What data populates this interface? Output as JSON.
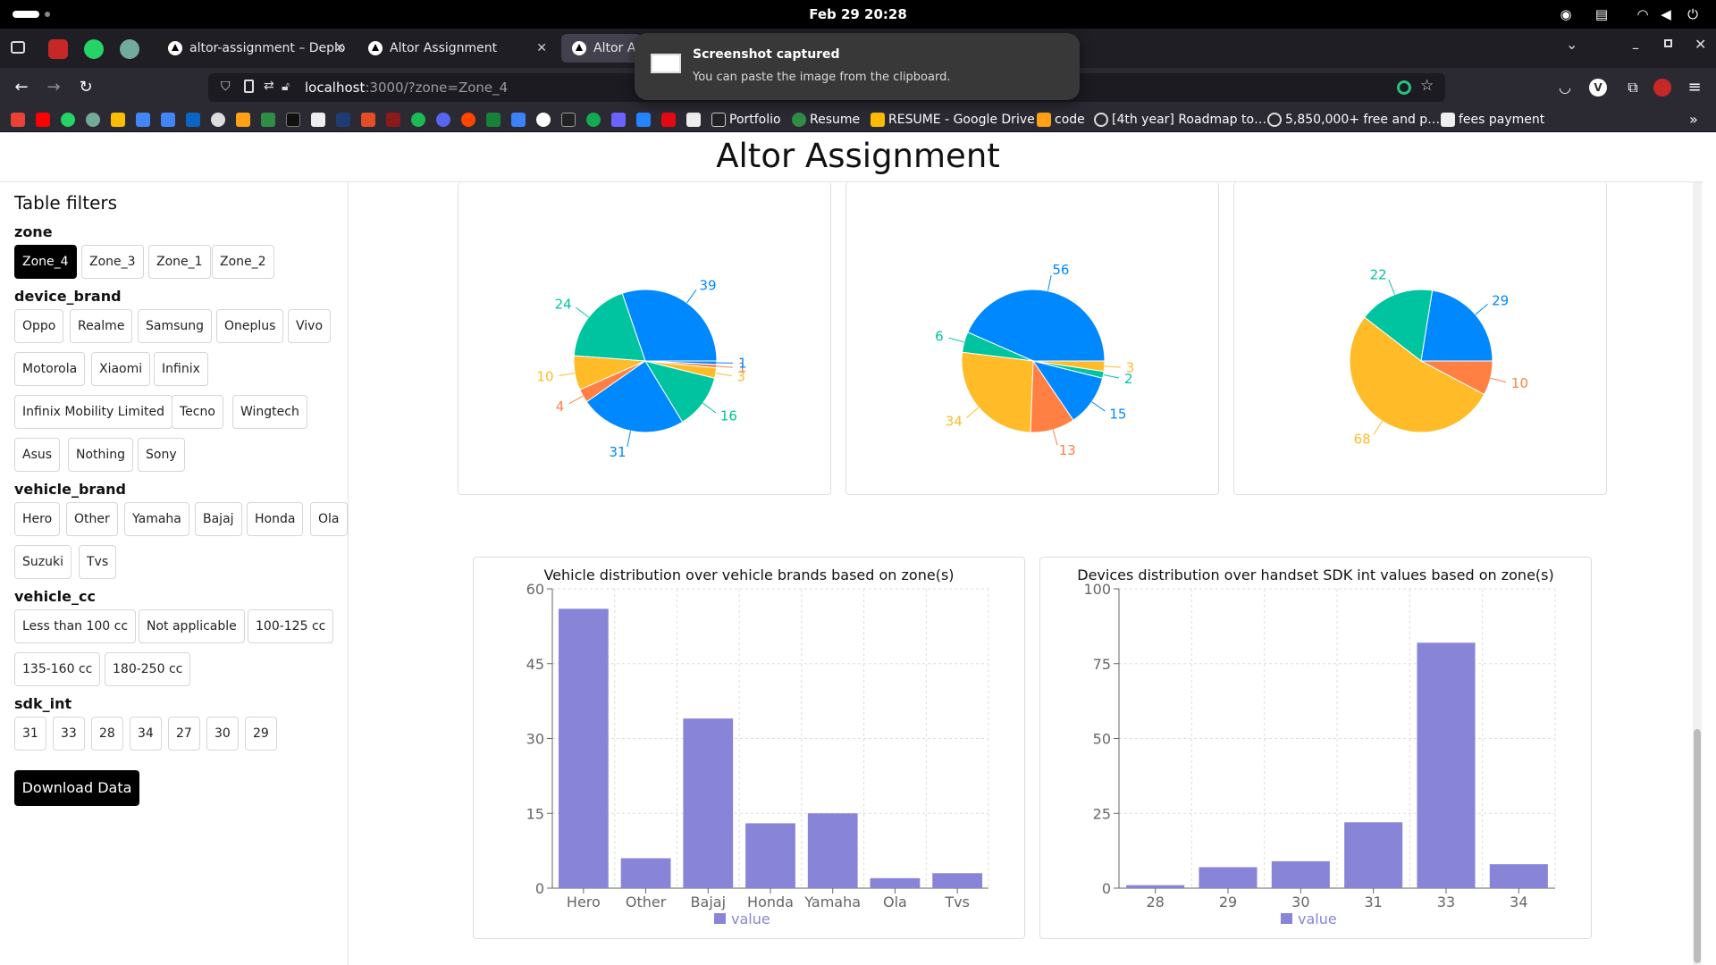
{
  "system": {
    "clock": "Feb 29  20:28",
    "tray_icons": [
      "steam-icon",
      "printer-icon",
      "wifi-icon",
      "volume-icon",
      "power-icon"
    ]
  },
  "browser": {
    "tabs": [
      {
        "title": "altor-assignment – Deplo",
        "close": "✕"
      },
      {
        "title": "Altor Assignment",
        "close": "✕"
      },
      {
        "title": "Altor As",
        "close": ""
      }
    ],
    "url_host": "localhost",
    "url_rest": ":3000/?zone=Zone_4",
    "bookmarks": [
      {
        "label": "Portfolio"
      },
      {
        "label": "Resume"
      },
      {
        "label": "RESUME - Google Drive"
      },
      {
        "label": "code"
      },
      {
        "label": "[4th year] Roadmap to…"
      },
      {
        "label": "5,850,000+ free and p…"
      },
      {
        "label": "fees payment"
      }
    ]
  },
  "notification": {
    "title": "Screenshot captured",
    "body": "You can paste the image from the clipboard."
  },
  "page": {
    "title": "Altor Assignment",
    "filters_heading": "Table filters",
    "download_label": "Download Data"
  },
  "filters": {
    "zone": {
      "label": "zone",
      "options": [
        "Zone_4",
        "Zone_3",
        "Zone_1",
        "Zone_2"
      ],
      "selected": "Zone_4"
    },
    "device_brand": {
      "label": "device_brand",
      "options": [
        "Oppo",
        "Realme",
        "Samsung",
        "Oneplus",
        "Vivo",
        "Motorola",
        "Xiaomi",
        "Infinix",
        "Infinix Mobility Limited",
        "Tecno",
        "Wingtech",
        "Asus",
        "Nothing",
        "Sony"
      ]
    },
    "vehicle_brand": {
      "label": "vehicle_brand",
      "options": [
        "Hero",
        "Other",
        "Yamaha",
        "Bajaj",
        "Honda",
        "Ola",
        "Suzuki",
        "Tvs"
      ]
    },
    "vehicle_cc": {
      "label": "vehicle_cc",
      "options": [
        "Less than 100 cc",
        "Not applicable",
        "100-125 cc",
        "135-160 cc",
        "180-250 cc"
      ]
    },
    "sdk_int": {
      "label": "sdk_int",
      "options": [
        "31",
        "33",
        "28",
        "34",
        "27",
        "30",
        "29"
      ]
    }
  },
  "colors": {
    "blue": "#0088fe",
    "green": "#00c49f",
    "yellow": "#ffbb28",
    "orange": "#ff8042",
    "bar": "#8884d8"
  },
  "chart_data": [
    {
      "type": "pie",
      "title": "",
      "slices": [
        {
          "value": 39,
          "color": "#0088fe"
        },
        {
          "value": 24,
          "color": "#00c49f"
        },
        {
          "value": 10,
          "color": "#ffbb28"
        },
        {
          "value": 4,
          "color": "#ff8042"
        },
        {
          "value": 31,
          "color": "#0088fe"
        },
        {
          "value": 16,
          "color": "#00c49f"
        },
        {
          "value": 3,
          "color": "#ffbb28"
        },
        {
          "value": 1,
          "color": "#ff8042"
        },
        {
          "value": 1,
          "color": "#0088fe"
        }
      ]
    },
    {
      "type": "pie",
      "title": "",
      "slices": [
        {
          "value": 56,
          "color": "#0088fe"
        },
        {
          "value": 6,
          "color": "#00c49f"
        },
        {
          "value": 34,
          "color": "#ffbb28"
        },
        {
          "value": 13,
          "color": "#ff8042"
        },
        {
          "value": 15,
          "color": "#0088fe"
        },
        {
          "value": 2,
          "color": "#00c49f"
        },
        {
          "value": 3,
          "color": "#ffbb28"
        }
      ]
    },
    {
      "type": "pie",
      "title": "",
      "slices": [
        {
          "value": 29,
          "color": "#0088fe"
        },
        {
          "value": 22,
          "color": "#00c49f"
        },
        {
          "value": 68,
          "color": "#ffbb28"
        },
        {
          "value": 10,
          "color": "#ff8042"
        }
      ]
    },
    {
      "type": "bar",
      "title": "Vehicle distribution over vehicle brands based on zone(s)",
      "categories": [
        "Hero",
        "Other",
        "Bajaj",
        "Honda",
        "Yamaha",
        "Ola",
        "Tvs"
      ],
      "series": [
        {
          "name": "value",
          "values": [
            56,
            6,
            34,
            13,
            15,
            2,
            3
          ]
        }
      ],
      "yticks": [
        0,
        15,
        30,
        45,
        60
      ],
      "ylim": [
        0,
        60
      ],
      "grid": true,
      "legend": "bottom"
    },
    {
      "type": "bar",
      "title": "Devices distribution over handset SDK int values based on zone(s)",
      "categories": [
        "28",
        "29",
        "30",
        "31",
        "33",
        "34"
      ],
      "series": [
        {
          "name": "value",
          "values": [
            1,
            7,
            9,
            22,
            82,
            8
          ]
        }
      ],
      "yticks": [
        0,
        25,
        50,
        75,
        100
      ],
      "ylim": [
        0,
        100
      ],
      "grid": true,
      "legend": "bottom"
    }
  ]
}
